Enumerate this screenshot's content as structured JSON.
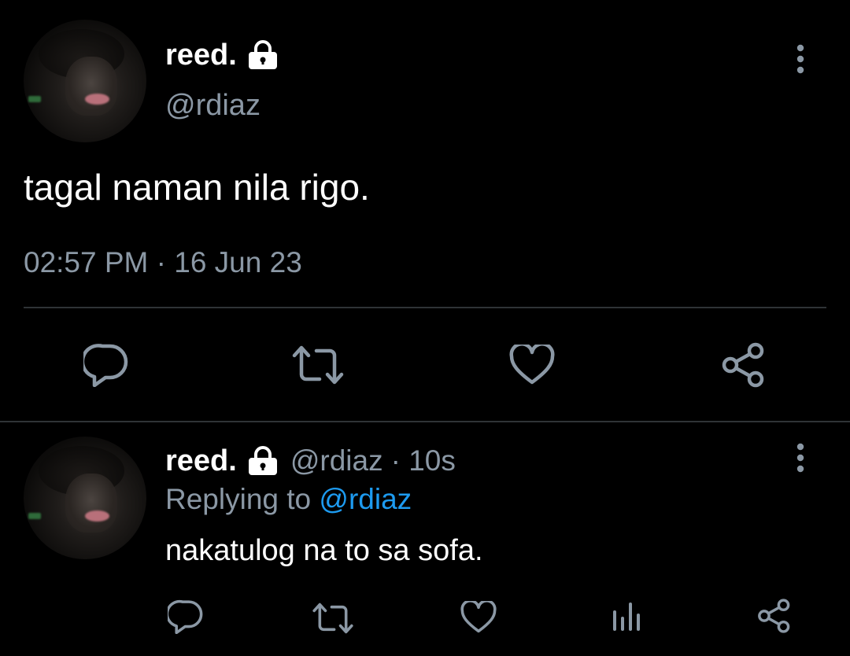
{
  "main_tweet": {
    "display_name": "reed.",
    "handle": "@rdiaz",
    "text": "tagal naman nila rigo.",
    "timestamp": "02:57 PM · 16 Jun 23",
    "actions": [
      "reply",
      "retweet",
      "like",
      "share"
    ]
  },
  "reply_tweet": {
    "display_name": "reed.",
    "handle": "@rdiaz",
    "time_ago": "· 10s",
    "replying_prefix": "Replying to",
    "replying_to": "@rdiaz",
    "text": "nakatulog na to sa sofa.",
    "actions": [
      "reply",
      "retweet",
      "like",
      "analytics",
      "share"
    ]
  },
  "colors": {
    "background": "#000000",
    "text": "#ffffff",
    "muted": "#8b98a5",
    "link": "#1d9bf0",
    "divider": "#2f3336"
  }
}
